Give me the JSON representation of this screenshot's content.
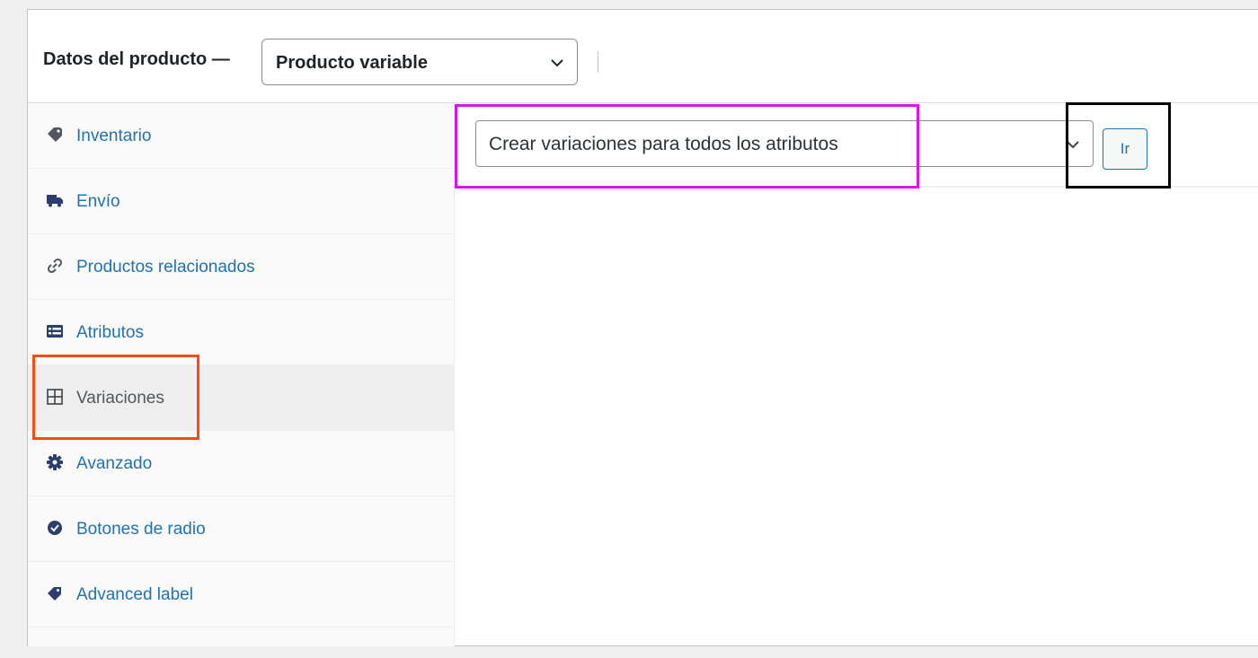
{
  "header": {
    "title": "Datos del producto —",
    "product_type": {
      "selected": "Producto variable"
    }
  },
  "sidebar": {
    "tabs": [
      {
        "label": "Inventario",
        "icon": "tag-icon",
        "active": false
      },
      {
        "label": "Envío",
        "icon": "truck-icon",
        "active": false
      },
      {
        "label": "Productos relacionados",
        "icon": "link-icon",
        "active": false
      },
      {
        "label": "Atributos",
        "icon": "list-table-icon",
        "active": false
      },
      {
        "label": "Variaciones",
        "icon": "grid-icon",
        "active": true
      },
      {
        "label": "Avanzado",
        "icon": "gear-icon",
        "active": false
      },
      {
        "label": "Botones de radio",
        "icon": "check-circle-icon",
        "active": false
      },
      {
        "label": "Advanced label",
        "icon": "label-tag-icon",
        "active": false
      }
    ]
  },
  "variations": {
    "bulk_action": {
      "selected": "Crear variaciones para todos los atributos"
    },
    "go_label": "Ir"
  },
  "colors": {
    "link": "#2271b1",
    "highlight_magenta": "#d815ee",
    "highlight_black": "#000000",
    "highlight_orange": "#f24e1b"
  }
}
